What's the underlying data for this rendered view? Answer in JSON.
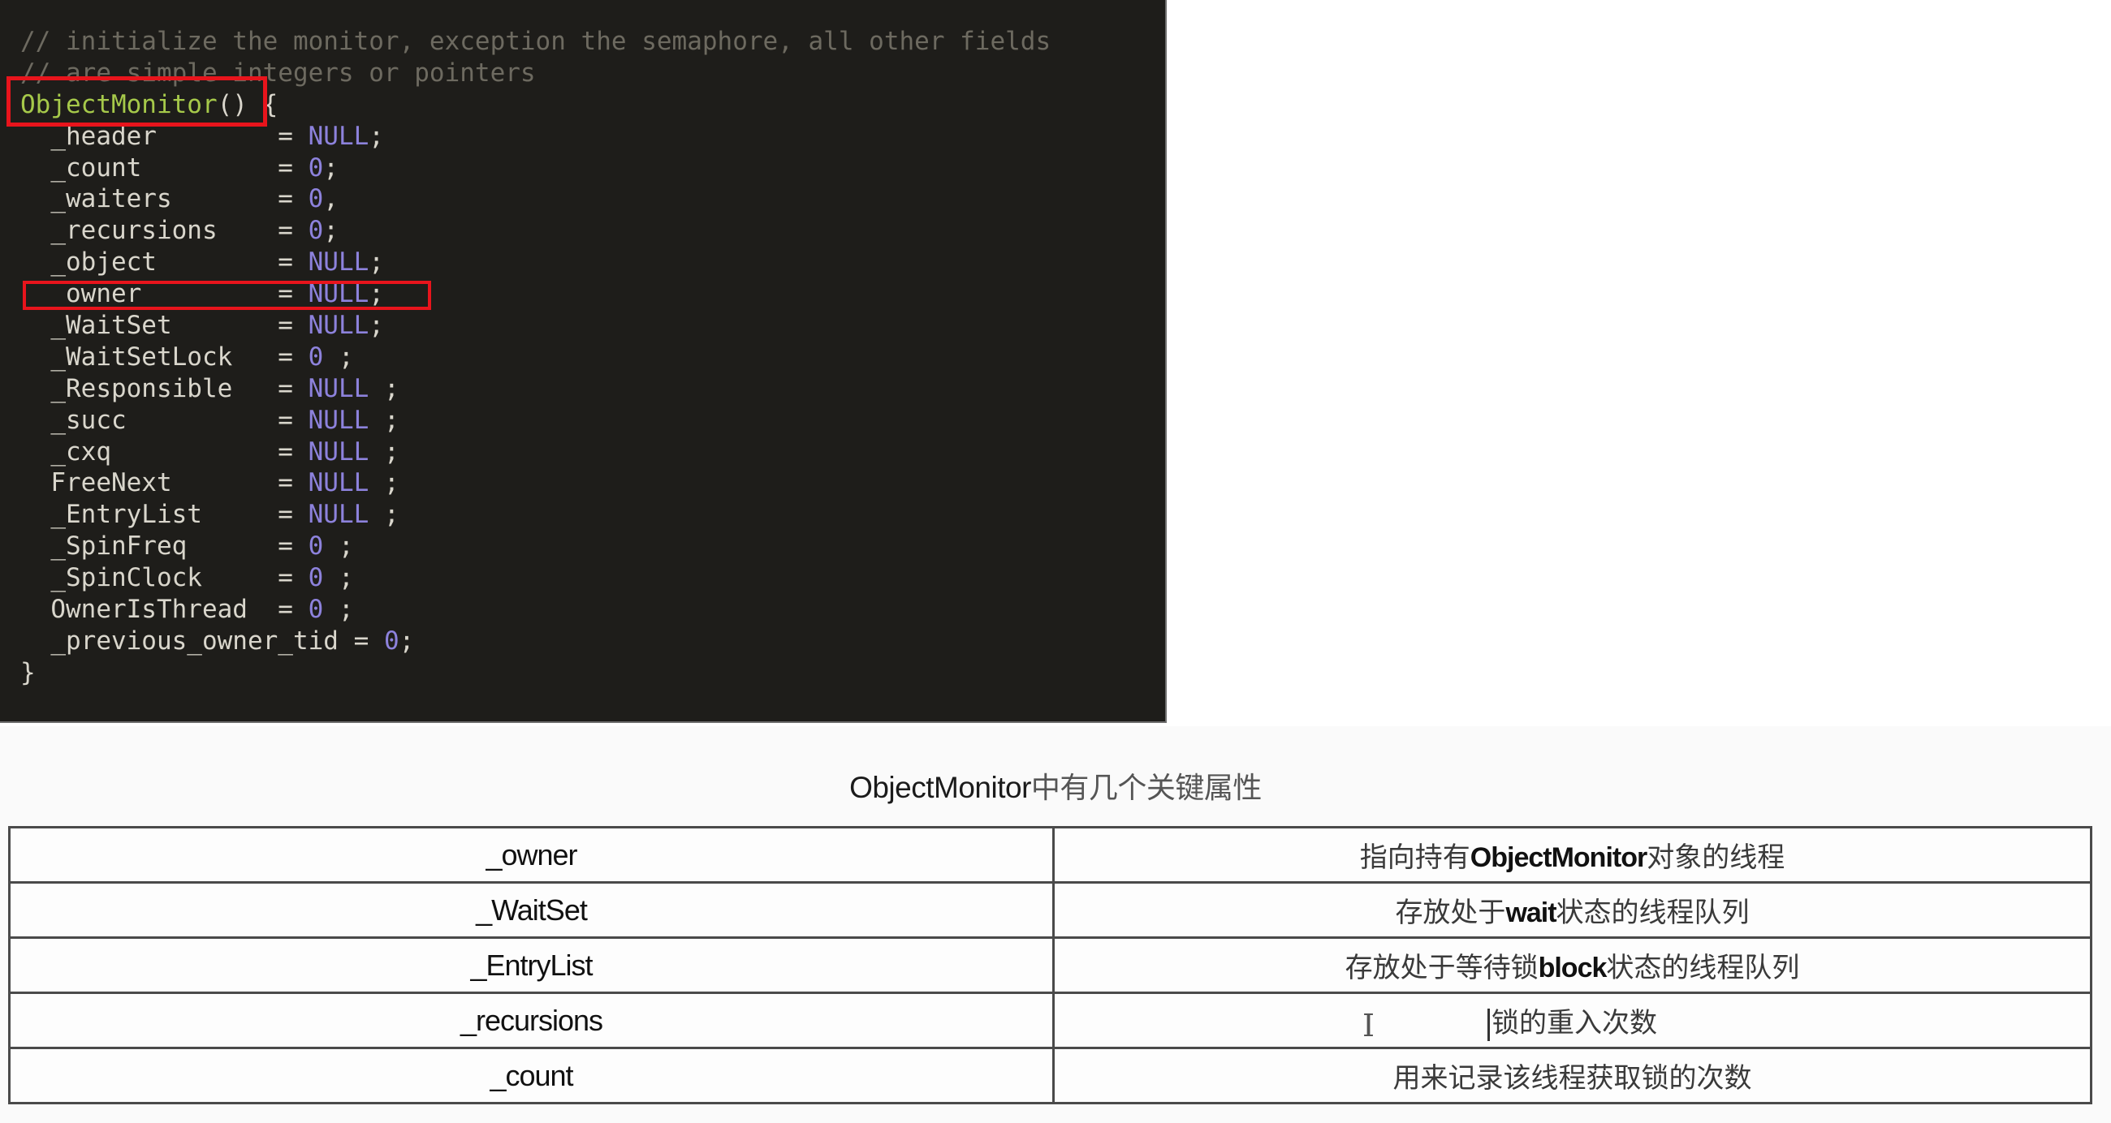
{
  "code_panel": {
    "language": "C++",
    "lines": [
      {
        "indent": "",
        "tokens": [
          {
            "t": "comment",
            "v": "// initialize the monitor, exception the semaphore, all other fields"
          }
        ]
      },
      {
        "indent": "",
        "tokens": [
          {
            "t": "comment",
            "v": "// are simple integers or pointers"
          }
        ]
      },
      {
        "indent": "",
        "tokens": [
          {
            "t": "func",
            "v": "ObjectMonitor"
          },
          {
            "t": "punct",
            "v": "() {"
          }
        ]
      },
      {
        "indent": "  ",
        "tokens": [
          {
            "t": "ident",
            "v": "_header        "
          },
          {
            "t": "punct",
            "v": "= "
          },
          {
            "t": "null",
            "v": "NULL"
          },
          {
            "t": "punct",
            "v": ";"
          }
        ]
      },
      {
        "indent": "  ",
        "tokens": [
          {
            "t": "ident",
            "v": "_count         "
          },
          {
            "t": "punct",
            "v": "= "
          },
          {
            "t": "num",
            "v": "0"
          },
          {
            "t": "punct",
            "v": ";"
          }
        ]
      },
      {
        "indent": "  ",
        "tokens": [
          {
            "t": "ident",
            "v": "_waiters       "
          },
          {
            "t": "punct",
            "v": "= "
          },
          {
            "t": "num",
            "v": "0"
          },
          {
            "t": "punct",
            "v": ","
          }
        ]
      },
      {
        "indent": "  ",
        "tokens": [
          {
            "t": "ident",
            "v": "_recursions    "
          },
          {
            "t": "punct",
            "v": "= "
          },
          {
            "t": "num",
            "v": "0"
          },
          {
            "t": "punct",
            "v": ";"
          }
        ]
      },
      {
        "indent": "  ",
        "tokens": [
          {
            "t": "ident",
            "v": "_object        "
          },
          {
            "t": "punct",
            "v": "= "
          },
          {
            "t": "null",
            "v": "NULL"
          },
          {
            "t": "punct",
            "v": ";"
          }
        ]
      },
      {
        "indent": "  ",
        "tokens": [
          {
            "t": "ident",
            "v": "_owner         "
          },
          {
            "t": "punct",
            "v": "= "
          },
          {
            "t": "null",
            "v": "NULL"
          },
          {
            "t": "punct",
            "v": ";"
          }
        ]
      },
      {
        "indent": "  ",
        "tokens": [
          {
            "t": "ident",
            "v": "_WaitSet       "
          },
          {
            "t": "punct",
            "v": "= "
          },
          {
            "t": "null",
            "v": "NULL"
          },
          {
            "t": "punct",
            "v": ";"
          }
        ]
      },
      {
        "indent": "  ",
        "tokens": [
          {
            "t": "ident",
            "v": "_WaitSetLock   "
          },
          {
            "t": "punct",
            "v": "= "
          },
          {
            "t": "num",
            "v": "0"
          },
          {
            "t": "punct",
            "v": " ;"
          }
        ]
      },
      {
        "indent": "  ",
        "tokens": [
          {
            "t": "ident",
            "v": "_Responsible   "
          },
          {
            "t": "punct",
            "v": "= "
          },
          {
            "t": "null",
            "v": "NULL"
          },
          {
            "t": "punct",
            "v": " ;"
          }
        ]
      },
      {
        "indent": "  ",
        "tokens": [
          {
            "t": "ident",
            "v": "_succ          "
          },
          {
            "t": "punct",
            "v": "= "
          },
          {
            "t": "null",
            "v": "NULL"
          },
          {
            "t": "punct",
            "v": " ;"
          }
        ]
      },
      {
        "indent": "  ",
        "tokens": [
          {
            "t": "ident",
            "v": "_cxq           "
          },
          {
            "t": "punct",
            "v": "= "
          },
          {
            "t": "null",
            "v": "NULL"
          },
          {
            "t": "punct",
            "v": " ;"
          }
        ]
      },
      {
        "indent": "  ",
        "tokens": [
          {
            "t": "ident",
            "v": "FreeNext       "
          },
          {
            "t": "punct",
            "v": "= "
          },
          {
            "t": "null",
            "v": "NULL"
          },
          {
            "t": "punct",
            "v": " ;"
          }
        ]
      },
      {
        "indent": "  ",
        "tokens": [
          {
            "t": "ident",
            "v": "_EntryList     "
          },
          {
            "t": "punct",
            "v": "= "
          },
          {
            "t": "null",
            "v": "NULL"
          },
          {
            "t": "punct",
            "v": " ;"
          }
        ]
      },
      {
        "indent": "  ",
        "tokens": [
          {
            "t": "ident",
            "v": "_SpinFreq      "
          },
          {
            "t": "punct",
            "v": "= "
          },
          {
            "t": "num",
            "v": "0"
          },
          {
            "t": "punct",
            "v": " ;"
          }
        ]
      },
      {
        "indent": "  ",
        "tokens": [
          {
            "t": "ident",
            "v": "_SpinClock     "
          },
          {
            "t": "punct",
            "v": "= "
          },
          {
            "t": "num",
            "v": "0"
          },
          {
            "t": "punct",
            "v": " ;"
          }
        ]
      },
      {
        "indent": "  ",
        "tokens": [
          {
            "t": "ident",
            "v": "OwnerIsThread  "
          },
          {
            "t": "punct",
            "v": "= "
          },
          {
            "t": "num",
            "v": "0"
          },
          {
            "t": "punct",
            "v": " ;"
          }
        ]
      },
      {
        "indent": "  ",
        "tokens": [
          {
            "t": "ident",
            "v": "_previous_owner_tid "
          },
          {
            "t": "punct",
            "v": "= "
          },
          {
            "t": "num",
            "v": "0"
          },
          {
            "t": "punct",
            "v": ";"
          }
        ]
      },
      {
        "indent": "",
        "tokens": [
          {
            "t": "punct",
            "v": "}"
          }
        ]
      }
    ],
    "highlights": [
      "ObjectMonitor()",
      "_owner = NULL;"
    ],
    "highlight_color": "#e8141c"
  },
  "table_section": {
    "title_latin": "ObjectMonitor",
    "title_cjk": "中有几个关键属性",
    "rows": [
      {
        "key": "_owner",
        "desc": [
          {
            "cjk": "指向持有"
          },
          {
            "latin": "ObjectMonitor"
          },
          {
            "cjk": "对象的线程"
          }
        ]
      },
      {
        "key": "_WaitSet",
        "desc": [
          {
            "cjk": "存放处于"
          },
          {
            "latin": "wait"
          },
          {
            "cjk": "状态的线程队列"
          }
        ]
      },
      {
        "key": "_EntryList",
        "desc": [
          {
            "cjk": "存放处于等待锁"
          },
          {
            "latin": "block"
          },
          {
            "cjk": "状态的线程队列"
          }
        ]
      },
      {
        "key": "_recursions",
        "desc": [
          {
            "cjk": "锁的重入次数"
          }
        ],
        "has_caret": true
      },
      {
        "key": "_count",
        "desc": [
          {
            "cjk": "用来记录该线程获取锁的次数"
          }
        ]
      }
    ]
  },
  "cursor": {
    "type": "text-ibeam",
    "glyph": "I"
  }
}
